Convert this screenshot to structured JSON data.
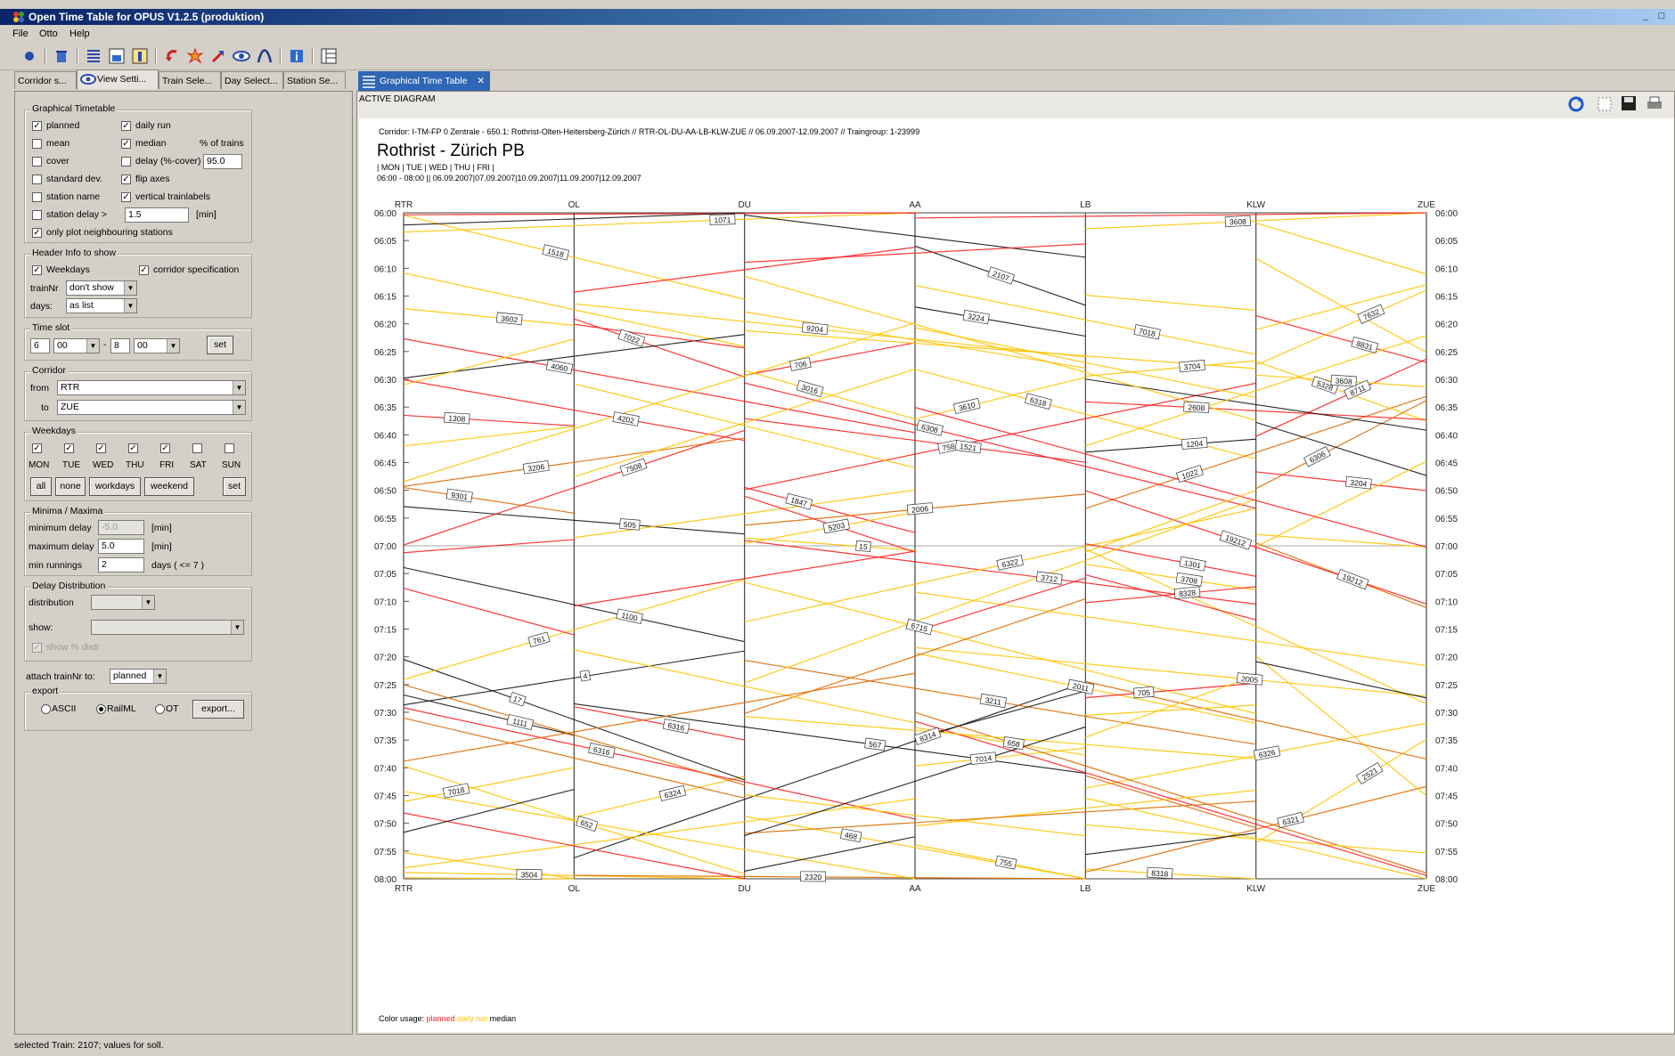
{
  "window": {
    "title": "Open Time Table for OPUS V1.2.5 (produktion)",
    "minimize": "_",
    "maximize": "□"
  },
  "menu": {
    "file": "File",
    "otto": "Otto",
    "help": "Help"
  },
  "toolbar": {
    "icons": [
      "circle-dot-icon",
      "trash-icon",
      "lines-icon",
      "chart-icon",
      "chart-alt-icon",
      "arrow-back-icon",
      "burst-icon",
      "arrow-flag-icon",
      "eye-icon",
      "curve-icon",
      "info-icon",
      "panel-icon"
    ]
  },
  "left_tabs": [
    "Corridor s...",
    "View Setti...",
    "Train Sele...",
    "Day Select...",
    "Station Se..."
  ],
  "active_left_tab": 1,
  "graphical_timetable": {
    "legend": "Graphical Timetable",
    "planned": "planned",
    "daily_run": "daily run",
    "mean": "mean",
    "median": "median",
    "pct_trains": "% of trains",
    "cover": "cover",
    "delay_cover": "delay (%-cover)",
    "delay_cover_value": "95.0",
    "std_dev": "standard dev.",
    "flip_axes": "flip axes",
    "station_name": "station name",
    "vertical_labels": "vertical trainlabels",
    "station_delay": "station delay >",
    "station_delay_value": "1.5",
    "min_unit": "[min]",
    "only_neighbouring": "only plot neighbouring stations"
  },
  "header_info": {
    "legend": "Header Info to show",
    "weekdays": "Weekdays",
    "corridor_spec": "corridor specification",
    "trainnr_label": "trainNr",
    "trainnr_value": "don't show",
    "days_label": "days:",
    "days_value": "as list"
  },
  "time_slot": {
    "legend": "Time slot",
    "from_h": "6",
    "from_m": "00",
    "sep": "-",
    "to_h": "8",
    "to_m": "00",
    "set": "set"
  },
  "corridor": {
    "legend": "Corridor",
    "from_label": "from",
    "from_value": "RTR",
    "to_label": "to",
    "to_value": "ZUE"
  },
  "weekdays": {
    "legend": "Weekdays",
    "days": [
      "MON",
      "TUE",
      "WED",
      "THU",
      "FRI",
      "SAT",
      "SUN"
    ],
    "checked": [
      true,
      true,
      true,
      true,
      true,
      false,
      false
    ],
    "all": "all",
    "none": "none",
    "workdays": "workdays",
    "weekend": "weekend",
    "set": "set"
  },
  "minima": {
    "legend": "Minima / Maxima",
    "min_delay": "minimum delay",
    "min_delay_value": "-5.0",
    "max_delay": "maximum delay",
    "max_delay_value": "5.0",
    "min_unit": "[min]",
    "min_runnings": "min runnings",
    "min_runnings_value": "2",
    "days_note": "days ( <= 7 )"
  },
  "delay_dist": {
    "legend": "Delay Distribution",
    "distribution": "distribution",
    "show": "show:",
    "show_pct": "show % distr"
  },
  "attach": {
    "label": "attach trainNr to:",
    "value": "planned"
  },
  "export": {
    "legend": "export",
    "ascii": "ASCII",
    "railml": "RailML",
    "ot": "OT",
    "button": "export..."
  },
  "right_tab": {
    "label": "Graphical Time Table",
    "close": "✕"
  },
  "active_diagram": "ACTIVE DIAGRAM",
  "diagram": {
    "corridor_line": "Corridor: I-TM-FP 0 Zentrale - 650.1: Rothrist-Olten-Heitersberg-Zürich // RTR-OL-DU-AA-LB-KLW-ZUE // 06.09.2007-12.09.2007 // Traingroup: 1-23999",
    "title": "Rothrist - Zürich PB",
    "days_line": "| MON | TUE | WED | THU | FRI |",
    "dates_line": "06:00 - 08:00 ||  06.09.2007|07.09.2007|10.09.2007|11.09.2007|12.09.2007",
    "color_usage": "Color usage:",
    "legend_planned": "planned",
    "legend_daily": "daily run",
    "legend_median": "median",
    "colors": {
      "planned": "#ff2020",
      "daily": "#ffc400",
      "median": "#101010",
      "dailyDark": "#e06a00"
    }
  },
  "chart_data": {
    "type": "line",
    "stations": [
      "RTR",
      "OL",
      "DU",
      "AA",
      "LB",
      "KLW",
      "ZUE"
    ],
    "times": [
      "06:00",
      "06:05",
      "06:10",
      "06:15",
      "06:20",
      "06:25",
      "06:30",
      "06:35",
      "06:40",
      "06:45",
      "06:50",
      "06:55",
      "07:00",
      "07:05",
      "07:10",
      "07:15",
      "07:20",
      "07:25",
      "07:30",
      "07:35",
      "07:40",
      "07:45",
      "07:50",
      "07:55",
      "08:00"
    ],
    "train_labels": [
      "706",
      "3206",
      "6318",
      "2107",
      "4060",
      "8318",
      "658",
      "7018",
      "2005",
      "1847",
      "19212",
      "3016",
      "8314",
      "3608",
      "567",
      "505",
      "2006",
      "8831",
      "7014",
      "652",
      "15",
      "9204",
      "7018",
      "4",
      "1204",
      "1308",
      "468",
      "7508",
      "758",
      "6321",
      "6715",
      "1022",
      "3504",
      "3708",
      "3204",
      "6324",
      "19212",
      "4202",
      "6316",
      "5328",
      "1071",
      "3712",
      "2521",
      "1111",
      "7022",
      "8328",
      "8711",
      "6316",
      "3224",
      "6326",
      "3608",
      "6322",
      "1521",
      "2011",
      "1518",
      "17",
      "2320",
      "3610",
      "755",
      "3704",
      "1100",
      "3602",
      "9301",
      "3211",
      "6308",
      "5203",
      "705",
      "2608",
      "1301",
      "761",
      "7632",
      "6306"
    ],
    "series": [
      {
        "name": "planned"
      },
      {
        "name": "daily run"
      },
      {
        "name": "median"
      }
    ]
  },
  "statusbar": {
    "text": "selected Train: 2107; values for soll."
  }
}
